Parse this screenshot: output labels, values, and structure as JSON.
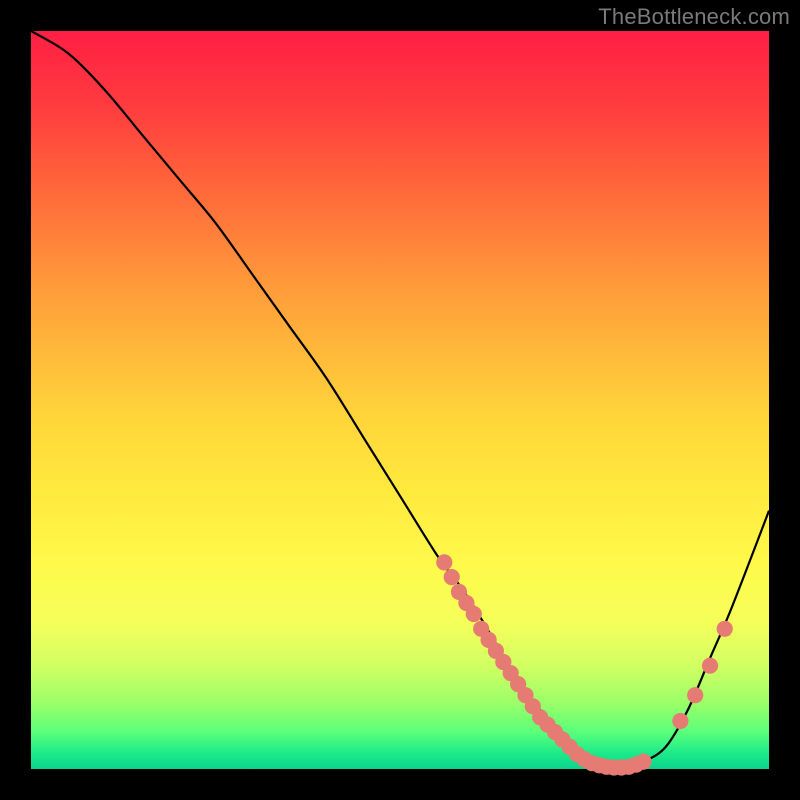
{
  "watermark": "TheBottleneck.com",
  "colors": {
    "page_bg": "#000000",
    "curve_stroke": "#000000",
    "dot_fill": "#e57b73"
  },
  "chart_data": {
    "type": "line",
    "title": "",
    "xlabel": "",
    "ylabel": "",
    "xlim": [
      0,
      100
    ],
    "ylim": [
      0,
      100
    ],
    "grid": false,
    "series": [
      {
        "name": "bottleneck-curve",
        "x": [
          0,
          5,
          10,
          15,
          20,
          25,
          30,
          35,
          40,
          45,
          50,
          55,
          58,
          60,
          63,
          66,
          69,
          72,
          75,
          78,
          80,
          83,
          86,
          89,
          92,
          95,
          100
        ],
        "values": [
          100,
          97,
          92,
          86,
          80,
          74,
          67,
          60,
          53,
          45,
          37,
          29,
          25,
          22,
          17,
          12,
          8,
          5,
          2,
          1,
          0,
          1,
          3,
          8,
          15,
          22,
          35
        ]
      }
    ],
    "markers": [
      {
        "x": 56,
        "y": 28
      },
      {
        "x": 57,
        "y": 26
      },
      {
        "x": 58,
        "y": 24
      },
      {
        "x": 59,
        "y": 22.5
      },
      {
        "x": 60,
        "y": 21
      },
      {
        "x": 61,
        "y": 19
      },
      {
        "x": 62,
        "y": 17.5
      },
      {
        "x": 63,
        "y": 16
      },
      {
        "x": 64,
        "y": 14.5
      },
      {
        "x": 65,
        "y": 13
      },
      {
        "x": 66,
        "y": 11.5
      },
      {
        "x": 67,
        "y": 10
      },
      {
        "x": 68,
        "y": 8.5
      },
      {
        "x": 69,
        "y": 7
      },
      {
        "x": 70,
        "y": 6
      },
      {
        "x": 71,
        "y": 5
      },
      {
        "x": 72,
        "y": 4
      },
      {
        "x": 73,
        "y": 3
      },
      {
        "x": 74,
        "y": 2
      },
      {
        "x": 75,
        "y": 1.3
      },
      {
        "x": 76,
        "y": 0.8
      },
      {
        "x": 77,
        "y": 0.5
      },
      {
        "x": 78,
        "y": 0.3
      },
      {
        "x": 79,
        "y": 0.2
      },
      {
        "x": 80,
        "y": 0.2
      },
      {
        "x": 81,
        "y": 0.3
      },
      {
        "x": 82,
        "y": 0.6
      },
      {
        "x": 83,
        "y": 1.0
      },
      {
        "x": 88,
        "y": 6.5
      },
      {
        "x": 90,
        "y": 10
      },
      {
        "x": 92,
        "y": 14
      },
      {
        "x": 94,
        "y": 19
      }
    ],
    "marker_radius_pct": 1.1
  }
}
